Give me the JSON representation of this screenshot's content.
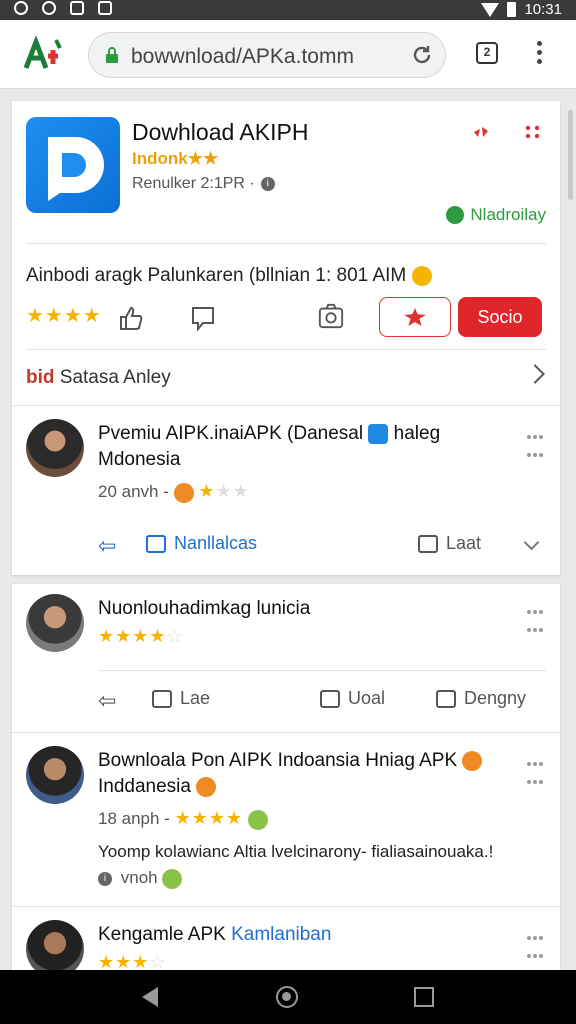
{
  "status_bar": {
    "time": "10:31"
  },
  "browser": {
    "url": "bowwnload/APKa.tomm",
    "tabs_count": "2"
  },
  "app": {
    "title": "Dowhload AKIPH",
    "subtitle": "Indonk★★",
    "meta": "Renulker 2:1PR ·",
    "now_badge": "Nladroilay",
    "description": "Ainbodi aragk Palunkaren (bllnian 1: 801 AIM",
    "rating_stars": 4,
    "button_label": "Socio"
  },
  "section": {
    "brand": "bid",
    "title": "Satasa Anley"
  },
  "reviews": [
    {
      "title_line1": "Pvemiu AIPK.inaiAPK (Danesal",
      "title_badge": "haleg",
      "title_line2": "Mdonesia",
      "meta": "20 anvh -",
      "stars": 2,
      "actions": {
        "like": "Nanllalcas",
        "comment": "Laat"
      }
    },
    {
      "title_line1": "Nuonlouhadimkag lunicia",
      "stars": 3.5,
      "actions": {
        "retweet": "Lae",
        "reply": "Uoal",
        "share": "Dengny"
      }
    },
    {
      "title_line1": "Bownloala Pon AIPK Indoansia Hniag APK",
      "title_line2": "Inddanesia",
      "meta": "18 anph -",
      "stars": 4,
      "body": "Yoomp kolawianc Altia lvelcinarony- fialiasainouaka.!",
      "footer": "vnoh"
    },
    {
      "title_line1": "Kengamle APK",
      "title_link": "Kamlaniban",
      "stars": 3
    }
  ]
}
